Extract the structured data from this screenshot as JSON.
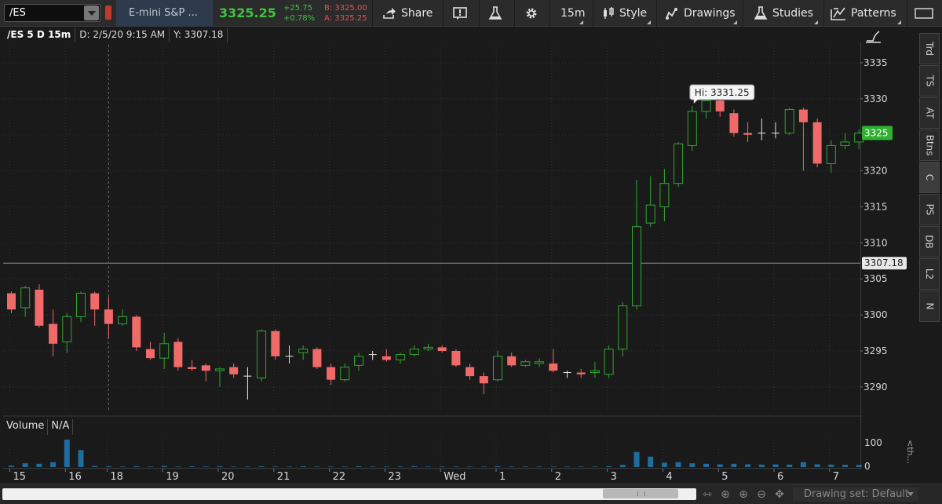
{
  "toolbar": {
    "symbol": "/ES",
    "description": "E-mini S&P ...",
    "last_price": "3325.25",
    "net_change": "+25.75",
    "pct_change": "+0.78%",
    "bid": "B: 3325.00",
    "ask": "A: 3325.25",
    "share_label": "Share",
    "timeframe_label": "15m",
    "style_label": "Style",
    "drawings_label": "Drawings",
    "studies_label": "Studies",
    "patterns_label": "Patterns"
  },
  "header": {
    "symbol_period": "/ES 5 D 15m",
    "date": "D: 2/5/20 9:15 AM",
    "y_value": "Y: 3307.18"
  },
  "side_tabs": [
    "Trd",
    "TS",
    "AT",
    "Btns",
    "C",
    "PS",
    "DB",
    "L2",
    "N"
  ],
  "side_collapse": "<th...",
  "volume_panel": {
    "label": "Volume",
    "value": "N/A",
    "axis_label": "100",
    "axis_label_zero": "0"
  },
  "bottom_bar": {
    "drawing_set": "Drawing set: Default"
  },
  "colors": {
    "up": "#2ea82e",
    "down": "#f06a6a",
    "price_badge": "#2fb02f",
    "volume": "#1f6c9e",
    "background": "#1a1a1a"
  },
  "chart_data": {
    "type": "candlestick",
    "y_ticks": [
      3290,
      3295,
      3300,
      3305,
      3310,
      3315,
      3320,
      3325,
      3330,
      3335
    ],
    "ylim": [
      3286.5,
      3337.5
    ],
    "x_labels": [
      "15",
      "16",
      "18",
      "19",
      "20",
      "21",
      "22",
      "23",
      "Wed",
      "1",
      "2",
      "3",
      "4",
      "5",
      "6",
      "7"
    ],
    "x_label_index": [
      0,
      4,
      7,
      11,
      15,
      19,
      23,
      27,
      31,
      35,
      39,
      43,
      47,
      51,
      55,
      59
    ],
    "current_price_label": "3325",
    "current_price": 3325.25,
    "crosshair_price_label": "3307.18",
    "crosshair_price": 3307.18,
    "crosshair_bar_index": 7,
    "high_label": "Hi: 3331.25",
    "high_bar_index": 49,
    "candles": [
      {
        "o": 3303,
        "h": 3303.25,
        "l": 3300.25,
        "c": 3300.75
      },
      {
        "o": 3301,
        "h": 3304,
        "l": 3299.75,
        "c": 3303.75
      },
      {
        "o": 3303.5,
        "h": 3304.25,
        "l": 3298.25,
        "c": 3298.5
      },
      {
        "o": 3298.75,
        "h": 3300.75,
        "l": 3294.25,
        "c": 3296
      },
      {
        "o": 3296.25,
        "h": 3300.25,
        "l": 3294.75,
        "c": 3299.75
      },
      {
        "o": 3299.75,
        "h": 3303.25,
        "l": 3299,
        "c": 3303
      },
      {
        "o": 3303,
        "h": 3303.25,
        "l": 3298.5,
        "c": 3300.75
      },
      {
        "o": 3300.75,
        "h": 3302.5,
        "l": 3296.75,
        "c": 3298.75
      },
      {
        "o": 3298.75,
        "h": 3300.75,
        "l": 3298.5,
        "c": 3299.75
      },
      {
        "o": 3299.75,
        "h": 3300,
        "l": 3295,
        "c": 3295.5
      },
      {
        "o": 3295.25,
        "h": 3296.25,
        "l": 3293.75,
        "c": 3294
      },
      {
        "o": 3294,
        "h": 3297.5,
        "l": 3292.5,
        "c": 3296
      },
      {
        "o": 3296.25,
        "h": 3296.75,
        "l": 3292.25,
        "c": 3292.75
      },
      {
        "o": 3292.75,
        "h": 3293.75,
        "l": 3292.25,
        "c": 3292.5
      },
      {
        "o": 3293,
        "h": 3293.25,
        "l": 3290.75,
        "c": 3292.25
      },
      {
        "o": 3292.25,
        "h": 3292.75,
        "l": 3290,
        "c": 3292.5
      },
      {
        "o": 3292.75,
        "h": 3293.25,
        "l": 3291.25,
        "c": 3291.75
      },
      {
        "o": 3291.5,
        "h": 3292.75,
        "l": 3288.25,
        "c": 3291.5
      },
      {
        "o": 3291.25,
        "h": 3298,
        "l": 3290.75,
        "c": 3297.75
      },
      {
        "o": 3297.75,
        "h": 3298,
        "l": 3293.75,
        "c": 3294.25
      },
      {
        "o": 3294.25,
        "h": 3295.75,
        "l": 3293.25,
        "c": 3294.25
      },
      {
        "o": 3294.75,
        "h": 3295.75,
        "l": 3293.75,
        "c": 3295.25
      },
      {
        "o": 3295.25,
        "h": 3295.5,
        "l": 3292.5,
        "c": 3292.75
      },
      {
        "o": 3292.75,
        "h": 3293.25,
        "l": 3290.25,
        "c": 3291
      },
      {
        "o": 3291,
        "h": 3293.25,
        "l": 3290.75,
        "c": 3292.75
      },
      {
        "o": 3293,
        "h": 3294.75,
        "l": 3292.25,
        "c": 3294.25
      },
      {
        "o": 3294.5,
        "h": 3295,
        "l": 3293.75,
        "c": 3294.5
      },
      {
        "o": 3294.25,
        "h": 3295.25,
        "l": 3293.5,
        "c": 3293.75
      },
      {
        "o": 3293.75,
        "h": 3294.75,
        "l": 3293.25,
        "c": 3294.5
      },
      {
        "o": 3294.5,
        "h": 3295.75,
        "l": 3294.25,
        "c": 3295.25
      },
      {
        "o": 3295.25,
        "h": 3296,
        "l": 3295,
        "c": 3295.5
      },
      {
        "o": 3295.5,
        "h": 3295.75,
        "l": 3294.75,
        "c": 3295
      },
      {
        "o": 3295,
        "h": 3295.25,
        "l": 3292.75,
        "c": 3293
      },
      {
        "o": 3292.75,
        "h": 3293.25,
        "l": 3291,
        "c": 3291.5
      },
      {
        "o": 3291.5,
        "h": 3292,
        "l": 3289,
        "c": 3290.5
      },
      {
        "o": 3291,
        "h": 3295,
        "l": 3290.75,
        "c": 3294.25
      },
      {
        "o": 3294.25,
        "h": 3294.75,
        "l": 3292.75,
        "c": 3293
      },
      {
        "o": 3293,
        "h": 3293.75,
        "l": 3292.75,
        "c": 3293.5
      },
      {
        "o": 3293.25,
        "h": 3294,
        "l": 3292.75,
        "c": 3293.5
      },
      {
        "o": 3293.25,
        "h": 3295.25,
        "l": 3292,
        "c": 3292.25
      },
      {
        "o": 3292,
        "h": 3292.25,
        "l": 3291.25,
        "c": 3292
      },
      {
        "o": 3292,
        "h": 3292.5,
        "l": 3291.25,
        "c": 3291.75
      },
      {
        "o": 3292,
        "h": 3293.5,
        "l": 3291.25,
        "c": 3292.25
      },
      {
        "o": 3291.75,
        "h": 3295.75,
        "l": 3291.25,
        "c": 3295.25
      },
      {
        "o": 3295.25,
        "h": 3301.75,
        "l": 3294.25,
        "c": 3301.25
      },
      {
        "o": 3301.25,
        "h": 3318.75,
        "l": 3300.75,
        "c": 3312.25
      },
      {
        "o": 3312.75,
        "h": 3319.25,
        "l": 3312.25,
        "c": 3315.25
      },
      {
        "o": 3315,
        "h": 3320.25,
        "l": 3313,
        "c": 3318.25
      },
      {
        "o": 3318.25,
        "h": 3324,
        "l": 3317.75,
        "c": 3323.75
      },
      {
        "o": 3323.5,
        "h": 3329,
        "l": 3322.75,
        "c": 3328.25
      },
      {
        "o": 3328.25,
        "h": 3331.25,
        "l": 3327.25,
        "c": 3329.75
      },
      {
        "o": 3329.75,
        "h": 3330.5,
        "l": 3327.5,
        "c": 3328.25
      },
      {
        "o": 3328,
        "h": 3328.5,
        "l": 3324.75,
        "c": 3325.25
      },
      {
        "o": 3325.25,
        "h": 3326.75,
        "l": 3324,
        "c": 3325
      },
      {
        "o": 3325.25,
        "h": 3327.25,
        "l": 3324.25,
        "c": 3325.25
      },
      {
        "o": 3325.25,
        "h": 3326.75,
        "l": 3324.5,
        "c": 3325.25
      },
      {
        "o": 3325.25,
        "h": 3328.75,
        "l": 3325,
        "c": 3328.5
      },
      {
        "o": 3328.5,
        "h": 3328.75,
        "l": 3320,
        "c": 3326.75
      },
      {
        "o": 3326.75,
        "h": 3327.25,
        "l": 3320.5,
        "c": 3321
      },
      {
        "o": 3321,
        "h": 3324.25,
        "l": 3319.75,
        "c": 3323.5
      },
      {
        "o": 3323.5,
        "h": 3325.25,
        "l": 3323,
        "c": 3324
      },
      {
        "o": 3324,
        "h": 3325.75,
        "l": 3323,
        "c": 3325.25
      }
    ],
    "volume": [
      5,
      14,
      12,
      18,
      100,
      62,
      4,
      3,
      2,
      3,
      2,
      4,
      2,
      3,
      2,
      3,
      2,
      2,
      3,
      2,
      2,
      3,
      2,
      2,
      2,
      3,
      2,
      2,
      2,
      3,
      2,
      2,
      2,
      2,
      2,
      3,
      2,
      2,
      2,
      2,
      2,
      2,
      2,
      3,
      8,
      55,
      38,
      16,
      18,
      14,
      12,
      10,
      12,
      10,
      9,
      10,
      9,
      18,
      10,
      9,
      8,
      8
    ]
  }
}
